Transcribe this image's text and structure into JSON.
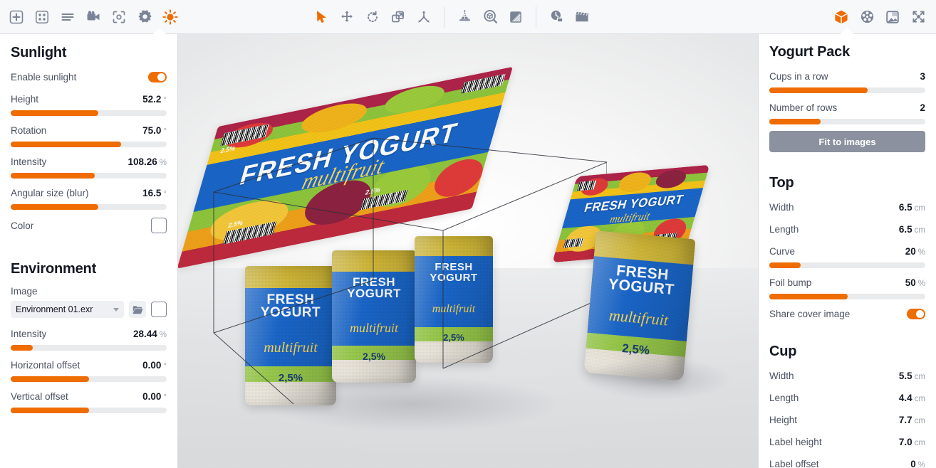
{
  "app": {
    "accent": "#ef6c00",
    "slider_track": "#e9eaec",
    "toolbar_bg": "#f7f8fa"
  },
  "toolbar": {
    "left_icons": [
      {
        "name": "add-object-icon",
        "label": "Add"
      },
      {
        "name": "scene-grid-icon",
        "label": "Scene"
      },
      {
        "name": "list-menu-icon",
        "label": "Menu"
      },
      {
        "name": "camera-icon",
        "label": "Camera"
      },
      {
        "name": "viewport-capture-icon",
        "label": "Capture"
      },
      {
        "name": "settings-gear-icon",
        "label": "Settings"
      },
      {
        "name": "sunlight-icon",
        "label": "Sunlight"
      }
    ],
    "center_icons": [
      {
        "name": "select-arrow-icon",
        "label": "Select"
      },
      {
        "name": "move-icon",
        "label": "Move"
      },
      {
        "name": "rotate-icon",
        "label": "Rotate"
      },
      {
        "name": "scale-icon",
        "label": "Scale"
      },
      {
        "name": "distribute-icon",
        "label": "Distribute"
      },
      {
        "name": "light-setup-icon",
        "label": "Light setup"
      },
      {
        "name": "inspect-object-icon",
        "label": "Inspect"
      },
      {
        "name": "gradient-material-icon",
        "label": "Material"
      },
      {
        "name": "render-time-icon",
        "label": "Render"
      },
      {
        "name": "animation-clapper-icon",
        "label": "Animation"
      }
    ],
    "right_icons": [
      {
        "name": "cube-object-icon",
        "label": "Object"
      },
      {
        "name": "sphere-material-icon",
        "label": "Material"
      },
      {
        "name": "background-image-icon",
        "label": "Background"
      },
      {
        "name": "fit-to-view-icon",
        "label": "Fit view"
      }
    ]
  },
  "left_panel": {
    "sunlight": {
      "title": "Sunlight",
      "enable": {
        "label": "Enable sunlight",
        "on": true
      },
      "params": [
        {
          "label": "Height",
          "value": "52.2",
          "unit": "°",
          "fill": 56
        },
        {
          "label": "Rotation",
          "value": "75.0",
          "unit": "°",
          "fill": 71
        },
        {
          "label": "Intensity",
          "value": "108.26",
          "unit": "%",
          "fill": 54
        },
        {
          "label": "Angular size (blur)",
          "value": "16.5",
          "unit": "°",
          "fill": 56
        }
      ],
      "color": {
        "label": "Color",
        "swatch": "#ffffff"
      }
    },
    "environment": {
      "title": "Environment",
      "image": {
        "label": "Image",
        "value": "Environment 01.exr",
        "swatch": "#ffffff"
      },
      "params": [
        {
          "label": "Intensity",
          "value": "28.44",
          "unit": "%",
          "fill": 14
        },
        {
          "label": "Horizontal offset",
          "value": "0.00",
          "unit": "°",
          "fill": 50
        },
        {
          "label": "Vertical offset",
          "value": "0.00",
          "unit": "°",
          "fill": 50
        }
      ]
    }
  },
  "right_panel": {
    "pack": {
      "title": "Yogurt Pack",
      "params": [
        {
          "label": "Cups in a row",
          "value": "3",
          "unit": "",
          "fill": 63
        },
        {
          "label": "Number of rows",
          "value": "2",
          "unit": "",
          "fill": 33
        }
      ],
      "fit_button": "Fit to images"
    },
    "top": {
      "title": "Top",
      "rows": [
        {
          "label": "Width",
          "value": "6.5",
          "unit": "cm",
          "fill": null
        },
        {
          "label": "Length",
          "value": "6.5",
          "unit": "cm",
          "fill": null
        },
        {
          "label": "Curve",
          "value": "20",
          "unit": "%",
          "fill": 20
        },
        {
          "label": "Foil bump",
          "value": "50",
          "unit": "%",
          "fill": 50
        }
      ],
      "share_cover": {
        "label": "Share cover image",
        "on": true
      }
    },
    "cup": {
      "title": "Cup",
      "rows": [
        {
          "label": "Width",
          "value": "5.5",
          "unit": "cm"
        },
        {
          "label": "Length",
          "value": "4.4",
          "unit": "cm"
        },
        {
          "label": "Height",
          "value": "7.7",
          "unit": "cm"
        },
        {
          "label": "Label height",
          "value": "7.0",
          "unit": "cm"
        },
        {
          "label": "Label offset",
          "value": "0",
          "unit": "%"
        }
      ]
    }
  },
  "viewport": {
    "product": {
      "brand_line1": "FRESH YOGURT",
      "brand_line1a": "FRESH",
      "brand_line1b": "YOGURT",
      "brand_line2": "multifruit",
      "fat_percent": "2,5%",
      "lid_percent": "2.5%"
    }
  }
}
